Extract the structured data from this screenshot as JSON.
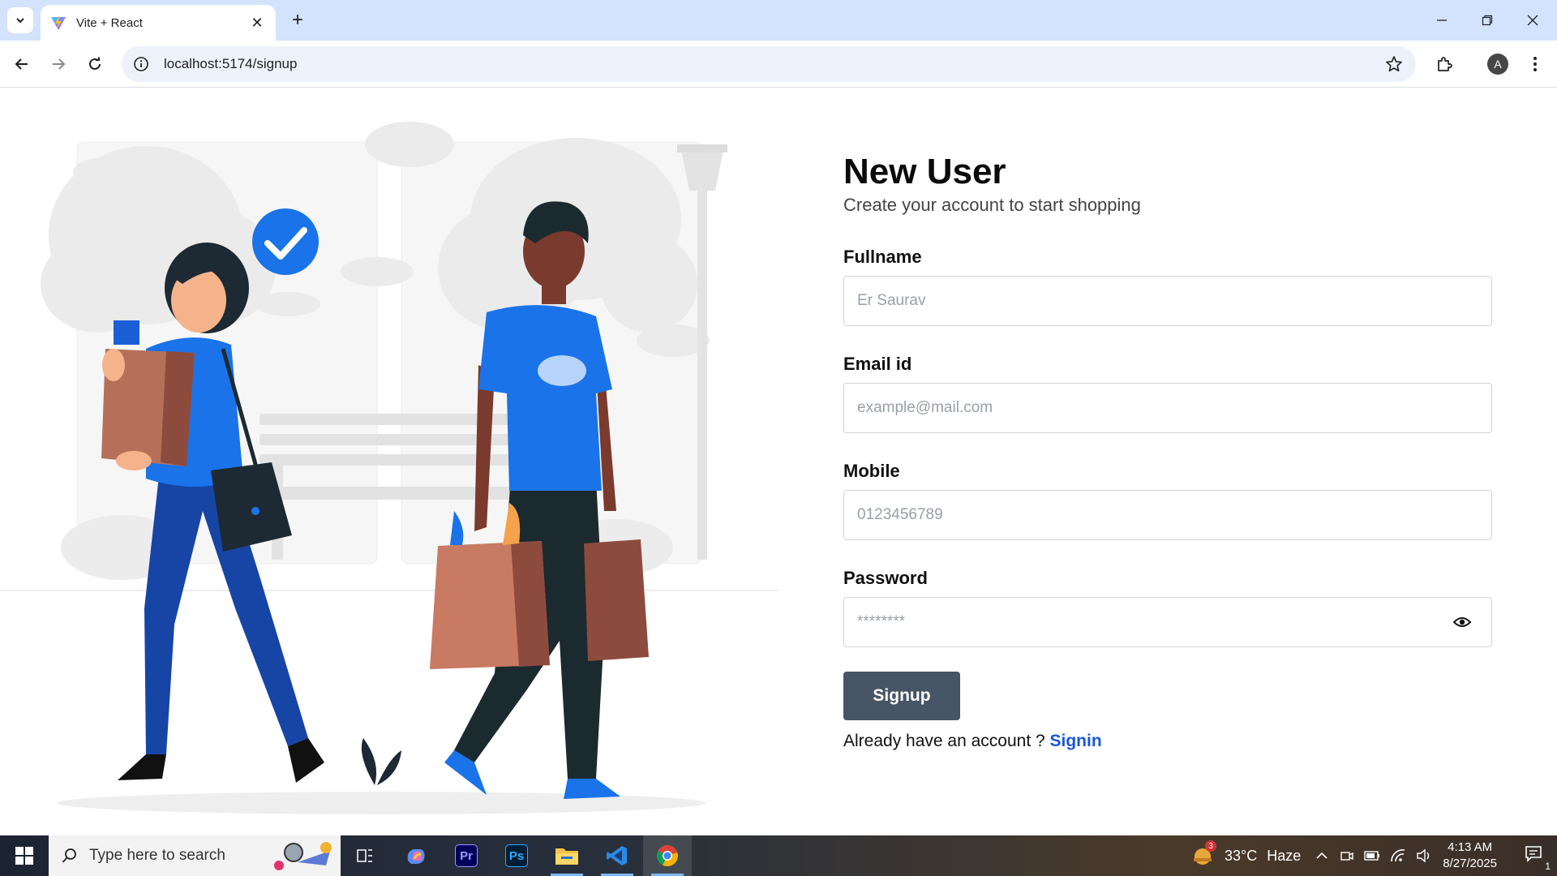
{
  "browser": {
    "tab_title": "Vite + React",
    "url": "localhost:5174/signup",
    "profile_initial": "A"
  },
  "form": {
    "title": "New User",
    "subtitle": "Create your account to start shopping",
    "fullname": {
      "label": "Fullname",
      "placeholder": "Er Saurav"
    },
    "email": {
      "label": "Email id",
      "placeholder": "example@mail.com"
    },
    "mobile": {
      "label": "Mobile",
      "placeholder": "0123456789"
    },
    "password": {
      "label": "Password",
      "placeholder": "********"
    },
    "submit_label": "Signup",
    "footer_text": "Already have an account ? ",
    "signin_label": "Signin"
  },
  "taskbar": {
    "search_placeholder": "Type here to search",
    "weather_temp": "33°C",
    "weather_desc": "Haze",
    "weather_badge": "3",
    "time": "4:13 AM",
    "date": "8/27/2025",
    "notification_count": "1",
    "apps": [
      "copilot-icon",
      "premiere-icon",
      "photoshop-icon",
      "file-explorer-icon",
      "vscode-icon",
      "chrome-icon"
    ]
  },
  "colors": {
    "tabbar_bg": "#d3e3fd",
    "button_bg": "#475466",
    "link": "#1a56db",
    "illustration_blue": "#1a73e8"
  }
}
